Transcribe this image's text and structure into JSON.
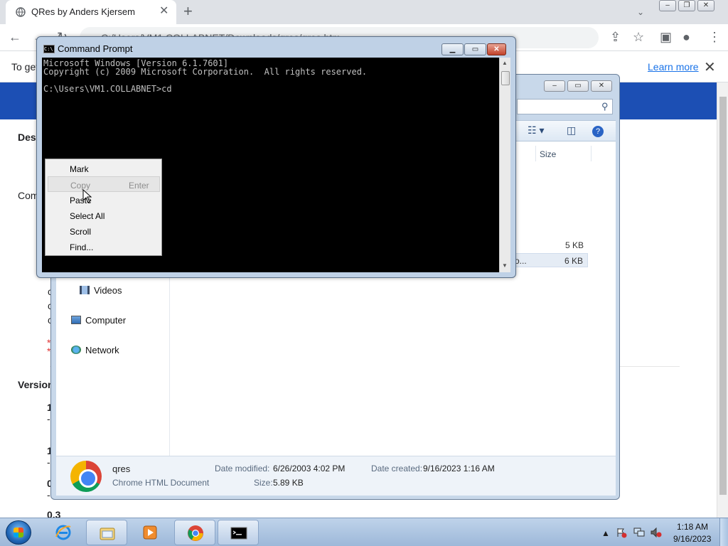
{
  "chrome": {
    "tab_title": "QRes by Anders Kjersem",
    "tab_close": "✕",
    "new_tab": "+",
    "tabs_dropdown": "⌄",
    "win_min": "–",
    "win_max": "❐",
    "win_close": "✕",
    "address_text": "C:/Users/VM1.COLLABNET/Downloads/qres/qres.htm",
    "infobar_text": "To get",
    "learn_more": "Learn more",
    "infobar_close": "✕"
  },
  "page_fragments": {
    "desc": "Des",
    "com": "Com",
    "version": "Version",
    "v1": "1",
    "v2": "1",
    "v3": "0",
    "v4": "0.3",
    "c1": "c",
    "c2": "c",
    "c3": "c",
    "star1": "*",
    "star2": "*",
    "dash": "-"
  },
  "explorer": {
    "col_size": "Size",
    "files": [
      {
        "name": "",
        "size": "5 KB"
      },
      {
        "name": "o...",
        "size": "6 KB"
      }
    ],
    "nav": {
      "videos": "Videos",
      "computer": "Computer",
      "network": "Network"
    },
    "details": {
      "name": "qres",
      "type": "Chrome HTML Document",
      "modified_label": "Date modified:",
      "modified_value": "6/26/2003 4:02 PM",
      "size_label": "Size:",
      "size_value": "5.89 KB",
      "created_label": "Date created:",
      "created_value": "9/16/2023 1:16 AM"
    }
  },
  "cmd": {
    "title": "Command Prompt",
    "icon_text": "C:\\",
    "lines": [
      "Microsoft Windows [Version 6.1.7601]",
      "Copyright (c) 2009 Microsoft Corporation.  All rights reserved.",
      "",
      "C:\\Users\\VM1.COLLABNET>cd"
    ]
  },
  "context_menu": [
    {
      "label": "Mark",
      "accel": "",
      "disabled": false
    },
    {
      "label": "Copy",
      "accel": "Enter",
      "disabled": true
    },
    {
      "label": "Paste",
      "accel": "",
      "disabled": false
    },
    {
      "label": "Select All",
      "accel": "",
      "disabled": false
    },
    {
      "label": "Scroll",
      "accel": "",
      "disabled": false
    },
    {
      "label": "Find...",
      "accel": "",
      "disabled": false
    }
  ],
  "taskbar": {
    "time": "1:18 AM",
    "date": "9/16/2023"
  },
  "colors": {
    "page_banner": "#1c4fb4",
    "console_bg": "#000000",
    "console_fg": "#c0c0c0",
    "link": "#1a73e8"
  }
}
